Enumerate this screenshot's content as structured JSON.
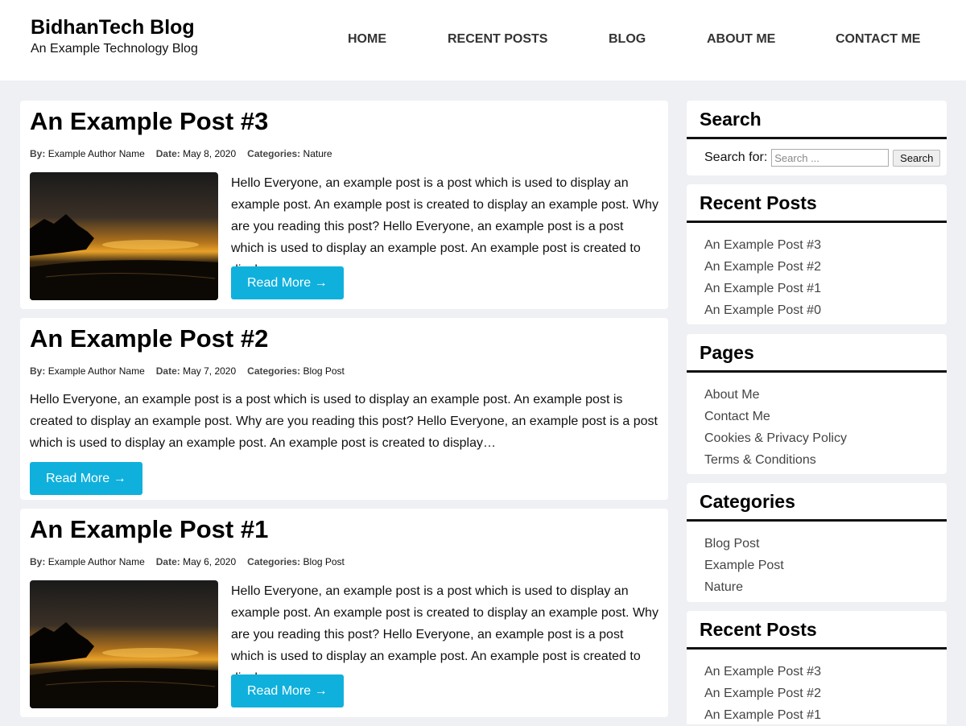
{
  "site": {
    "title": "BidhanTech Blog",
    "tagline": "An Example Technology Blog"
  },
  "nav": [
    "HOME",
    "RECENT POSTS",
    "BLOG",
    "ABOUT ME",
    "CONTACT ME"
  ],
  "labels": {
    "by": "By:",
    "date": "Date:",
    "categories": "Categories:"
  },
  "posts": [
    {
      "title": "An Example Post #3",
      "author": "Example Author Name",
      "date": "May 8, 2020",
      "category": "Nature",
      "excerpt": "Hello Everyone, an example post is a post which is used to display an example post. An example post is created to display an example post. Why are you reading this post? Hello Everyone, an example post is a post which is used to display an example post. An example post is created to display…",
      "read_more": "Read More →"
    },
    {
      "title": "An Example Post #2",
      "author": "Example Author Name",
      "date": "May 7, 2020",
      "category": "Blog Post",
      "excerpt": "Hello Everyone, an example post is a post which is used to display an example post. An example post is created to display an example post. Why are you reading this post? Hello Everyone, an example post is a post which is used to display an example post. An example post is created to display…",
      "read_more": "Read More →"
    },
    {
      "title": "An Example Post #1",
      "author": "Example Author Name",
      "date": "May 6, 2020",
      "category": "Blog Post",
      "excerpt": "Hello Everyone, an example post is a post which is used to display an example post. An example post is created to display an example post. Why are you reading this post? Hello Everyone, an example post is a post which is used to display an example post. An example post is created to display…",
      "read_more": "Read More →"
    }
  ],
  "sidebar": {
    "search": {
      "title": "Search",
      "label": "Search for:",
      "placeholder": "Search ...",
      "button": "Search"
    },
    "recent_posts": {
      "title": "Recent Posts",
      "items": [
        "An Example Post #3",
        "An Example Post #2",
        "An Example Post #1",
        "An Example Post #0"
      ]
    },
    "pages": {
      "title": "Pages",
      "items": [
        "About Me",
        "Contact Me",
        "Cookies & Privacy Policy",
        "Terms & Conditions"
      ]
    },
    "categories": {
      "title": "Categories",
      "items": [
        "Blog Post",
        "Example Post",
        "Nature"
      ]
    },
    "recent_posts_2": {
      "title": "Recent Posts",
      "items": [
        "An Example Post #3",
        "An Example Post #2",
        "An Example Post #1"
      ]
    }
  },
  "colors": {
    "accent": "#0fb0dc",
    "background": "#eef0f4",
    "card": "#ffffff"
  },
  "icons": {
    "thumbnail": "sunset-landscape-image"
  }
}
